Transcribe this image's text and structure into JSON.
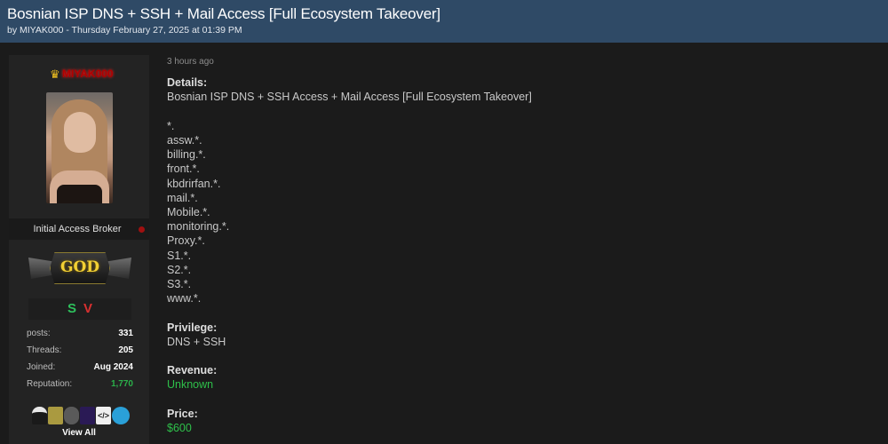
{
  "thread": {
    "title": "Bosnian ISP DNS + SSH + Mail Access [Full Ecosystem Takeover]",
    "meta": "by MIYAK000 - Thursday February 27, 2025 at 01:39 PM"
  },
  "author": {
    "username": "MIYAK000",
    "crown_icon": "crown-icon",
    "rank_title": "Initial Access Broker",
    "group_badge": "GOD",
    "badges": [
      "S",
      "V"
    ],
    "stats": [
      {
        "label": "posts:",
        "value": "331"
      },
      {
        "label": "Threads:",
        "value": "205"
      },
      {
        "label": "Joined:",
        "value": "Aug 2024"
      },
      {
        "label": "Reputation:",
        "value": "1,770"
      }
    ],
    "award_icons": [
      "hacker-award-icon",
      "matrix-award-icon",
      "hood-award-icon",
      "purple-award-icon",
      "code-award-icon",
      "globe-award-icon"
    ],
    "view_all": "View All",
    "colors": {
      "username": "#b00000",
      "reputation": "#2bb04a",
      "header": "#2f4a66"
    }
  },
  "post": {
    "time": "3 hours ago",
    "details_label": "Details:",
    "details_text": "Bosnian ISP DNS + SSH Access + Mail Access [Full Ecosystem Takeover]",
    "domains": [
      "*.",
      "assw.*.",
      "billing.*.",
      "front.*.",
      "kbdrirfan.*.",
      "mail.*.",
      "Mobile.*.",
      "monitoring.*.",
      "Proxy.*.",
      "S1.*.",
      "S2.*.",
      "S3.*.",
      "www.*."
    ],
    "privilege_label": "Privilege:",
    "privilege_value": "DNS + SSH",
    "revenue_label": "Revenue:",
    "revenue_value": "Unknown",
    "price_label": "Price:",
    "price_value": "$600"
  }
}
